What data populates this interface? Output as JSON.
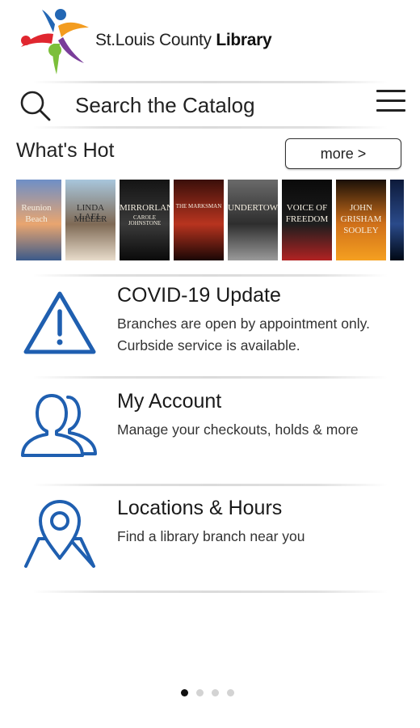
{
  "header": {
    "logo_text_regular": "St.Louis County",
    "logo_text_bold": "Library"
  },
  "search": {
    "placeholder": "Search the Catalog"
  },
  "whats_hot": {
    "title": "What's Hot",
    "more_label": "more >",
    "covers": [
      {
        "lines": [
          "Reunion",
          "Beach"
        ],
        "colors": [
          "#6e8fc7",
          "#e9a56f",
          "#3b5a8a"
        ]
      },
      {
        "lines": [
          "LINDA LAEL",
          "MILLER"
        ],
        "colors": [
          "#a8c6dc",
          "#7f6a55",
          "#e8dccb"
        ]
      },
      {
        "lines": [
          "MIRRORLAND",
          "CAROLE JOHNSTONE"
        ],
        "colors": [
          "#141414",
          "#3a3a3a",
          "#0a0a0a"
        ]
      },
      {
        "lines": [
          "THE MARKSMAN"
        ],
        "colors": [
          "#3a0f0a",
          "#b8341f",
          "#1a0705"
        ]
      },
      {
        "lines": [
          "UNDERTOW"
        ],
        "colors": [
          "#6a6a6a",
          "#2e2e2e",
          "#9a9a9a"
        ]
      },
      {
        "lines": [
          "VOICE OF",
          "FREEDOM"
        ],
        "colors": [
          "#0a0a0a",
          "#1e1e1e",
          "#b22222"
        ]
      },
      {
        "lines": [
          "JOHN",
          "GRISHAM",
          "SOOLEY"
        ],
        "colors": [
          "#1a1008",
          "#d0701a",
          "#f5a020"
        ]
      },
      {
        "lines": [],
        "colors": [
          "#0d1a3a",
          "#2a4a8a",
          "#000814"
        ]
      }
    ]
  },
  "items": [
    {
      "title": "COVID-19 Update",
      "desc_line1": "Branches are open by appointment only.",
      "desc_line2": "Curbside service is available."
    },
    {
      "title": "My Account",
      "desc_line1": "Manage your checkouts, holds & more"
    },
    {
      "title": "Locations & Hours",
      "desc_line1": "Find a library branch near you"
    }
  ],
  "pager": {
    "count": 4,
    "active_index": 0
  },
  "colors": {
    "icon_blue": "#1f5fb0",
    "logo_red": "#e0262f",
    "logo_orange": "#f39c1f",
    "logo_green": "#7cbf3a",
    "logo_blue": "#2367b4",
    "logo_purple": "#7a3d9a"
  }
}
